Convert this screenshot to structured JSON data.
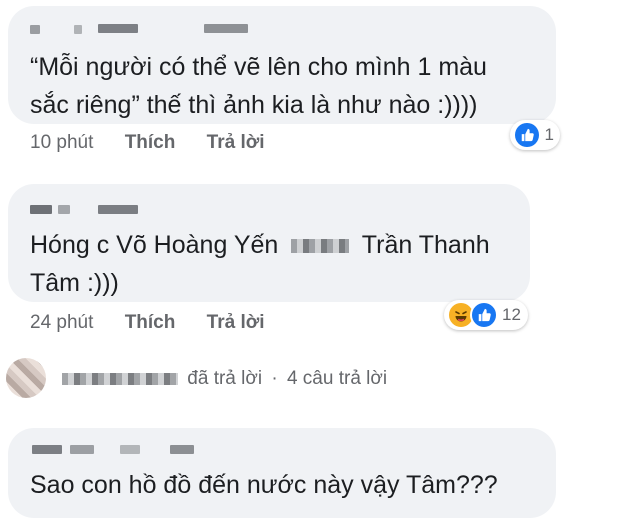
{
  "comments": [
    {
      "text_line1": "“Mỗi người có thể vẽ lên cho mình 1 màu",
      "text_line2": "sắc riêng” thế  thì ảnh kia là như nào :))))",
      "time": "10 phút",
      "like_label": "Thích",
      "reply_label": "Trả lời",
      "reaction_count": "1"
    },
    {
      "text_before_name": "Hóng c Võ Hoàng Yến",
      "text_after_name": "Trần Thanh",
      "text_line2": "Tâm :)))",
      "time": "24 phút",
      "like_label": "Thích",
      "reply_label": "Trả lời",
      "reaction_count": "12"
    },
    {
      "text_line1": "Sao con hồ đồ đến nước này vậy Tâm???"
    }
  ],
  "replies_summary": {
    "action": "đã trả lời",
    "separator": "·",
    "count_text": "4 câu trả lời"
  },
  "colors": {
    "bubble": "#f0f2f5",
    "meta": "#65676b",
    "like_blue": "#1877f2",
    "haha_yellow": "#f7b125"
  },
  "icons": [
    "like-icon",
    "haha-icon"
  ]
}
